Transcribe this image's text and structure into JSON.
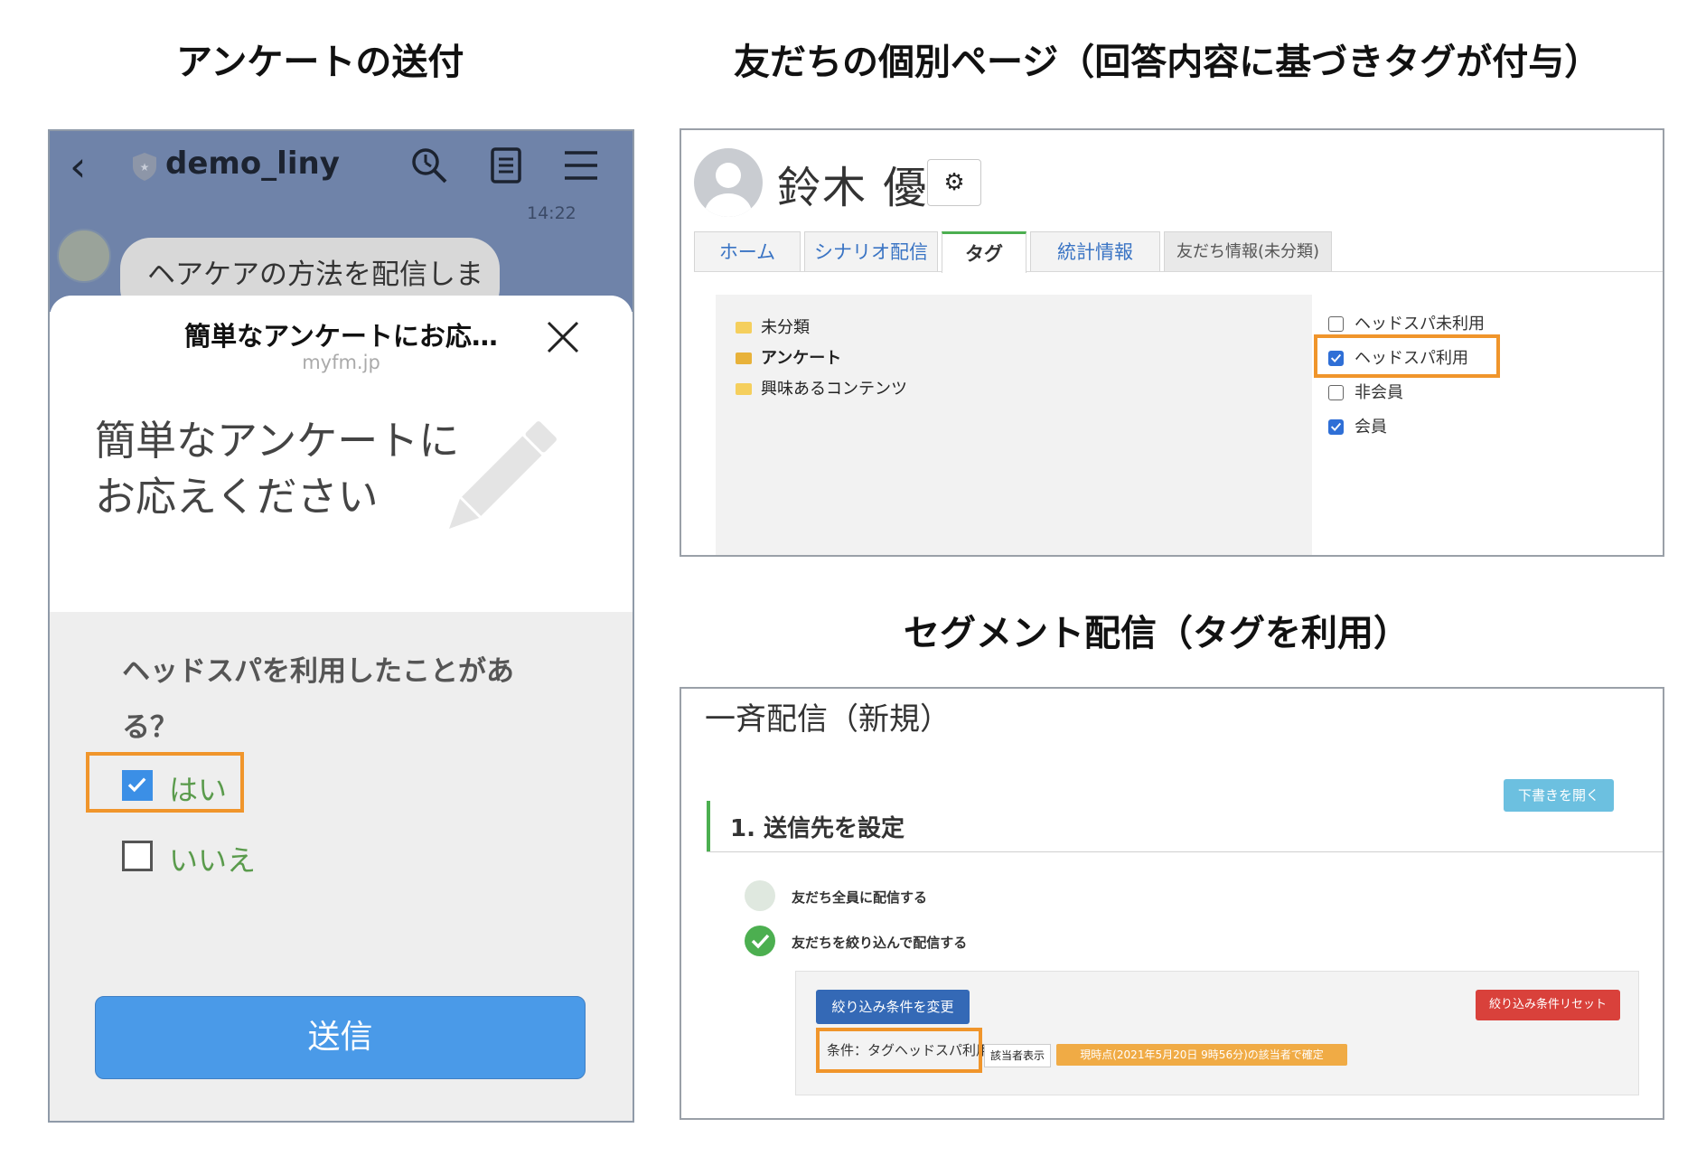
{
  "titles": {
    "survey": "アンケートの送付",
    "profile": "友だちの個別ページ（回答内容に基づきタグが付与）",
    "segment": "セグメント配信（タグを利用）"
  },
  "phone": {
    "account_name": "demo_liny",
    "time": "14:22",
    "message": "ヘアケアの方法を配信しま",
    "sheet_title": "簡単なアンケートにお応…",
    "sheet_domain": "myfm.jp",
    "hero_line1": "簡単なアンケートに",
    "hero_line2": "お応えください",
    "question_line1": "ヘッドスパを利用したことがあ",
    "question_line2": "る？",
    "options": [
      {
        "label": "はい",
        "checked": true
      },
      {
        "label": "いいえ",
        "checked": false
      }
    ],
    "submit_label": "送信",
    "colors": {
      "chat_bg": "#6f83a9",
      "submit": "#4a9ae8",
      "option_text": "#5a9b4c"
    }
  },
  "profile": {
    "name": "鈴木 優",
    "gear_icon": "gear-icon",
    "tabs": [
      "ホーム",
      "シナリオ配信",
      "タグ",
      "統計情報",
      "友だち情報(未分類)"
    ],
    "active_tab": "タグ",
    "folders": [
      "未分類",
      "アンケート",
      "興味あるコンテンツ"
    ],
    "tags": [
      {
        "label": "ヘッドスパ未利用",
        "checked": false
      },
      {
        "label": "ヘッドスパ利用",
        "checked": true
      },
      {
        "label": "非会員",
        "checked": false
      },
      {
        "label": "会員",
        "checked": true
      }
    ]
  },
  "segment": {
    "title": "一斉配信（新規）",
    "draft_button": "下書きを開く",
    "step_title": "1. 送信先を設定",
    "radio_all": "友だち全員に配信する",
    "radio_filter": "友だちを絞り込んで配信する",
    "change_button": "絞り込み条件を変更",
    "reset_button": "絞り込み条件リセット",
    "condition": "条件：タグヘッドスパ利用",
    "show_button": "該当者表示",
    "status": "現時点(2021年5月20日 9時56分)の該当者で確定"
  },
  "highlight_color": "#f0952b"
}
